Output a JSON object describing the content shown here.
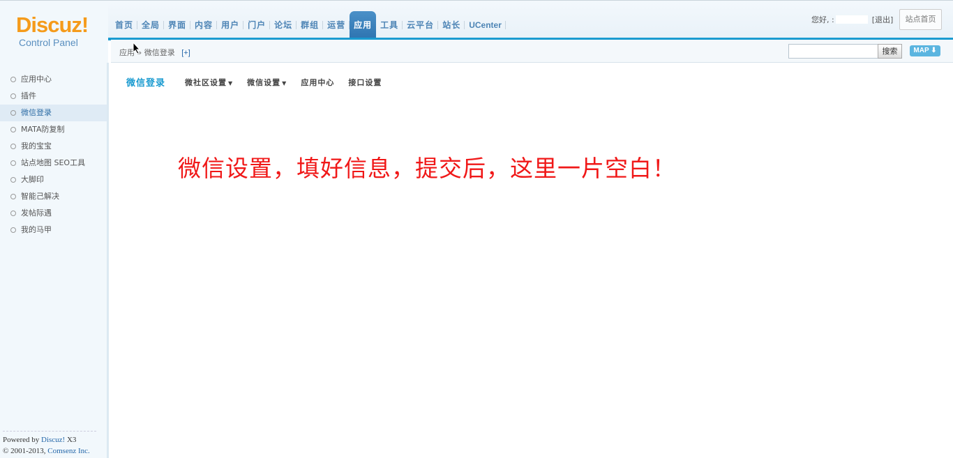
{
  "logo": {
    "main": "Discuz!",
    "sub": "Control Panel"
  },
  "topnav": {
    "items": [
      {
        "label": "首页",
        "active": false
      },
      {
        "label": "全局",
        "active": false
      },
      {
        "label": "界面",
        "active": false
      },
      {
        "label": "内容",
        "active": false
      },
      {
        "label": "用户",
        "active": false
      },
      {
        "label": "门户",
        "active": false
      },
      {
        "label": "论坛",
        "active": false
      },
      {
        "label": "群组",
        "active": false
      },
      {
        "label": "运营",
        "active": false
      },
      {
        "label": "应用",
        "active": true
      },
      {
        "label": "工具",
        "active": false
      },
      {
        "label": "云平台",
        "active": false
      },
      {
        "label": "站长",
        "active": false
      },
      {
        "label": "UCenter",
        "active": false
      }
    ]
  },
  "user": {
    "greeting": "您好, :",
    "logout": "[退出]",
    "home": "站点首页"
  },
  "breadcrumb": {
    "path": "应用 » 微信登录",
    "add": "[+]"
  },
  "search": {
    "placeholder": "",
    "button": "搜索",
    "map": "MAP"
  },
  "sidebar": {
    "items": [
      {
        "label": "应用中心",
        "active": false
      },
      {
        "label": "插件",
        "active": false
      },
      {
        "label": "微信登录",
        "active": true
      },
      {
        "label": "MATA防复制",
        "active": false
      },
      {
        "label": "我的宝宝",
        "active": false
      },
      {
        "label": "站点地图 SEO工具",
        "active": false
      },
      {
        "label": "大脚印",
        "active": false
      },
      {
        "label": "智能己解决",
        "active": false
      },
      {
        "label": "发帖际遇",
        "active": false
      },
      {
        "label": "我的马甲",
        "active": false
      }
    ],
    "footer": {
      "powered": "Powered by",
      "brand": "Discuz!",
      "version": "X3",
      "copyright": "© 2001-2013,",
      "company": "Comsenz Inc."
    }
  },
  "content": {
    "title": "微信登录",
    "tabs": [
      {
        "label": "微社区设置",
        "dropdown": true
      },
      {
        "label": "微信设置",
        "dropdown": true
      },
      {
        "label": "应用中心",
        "dropdown": false
      },
      {
        "label": "接口设置",
        "dropdown": false
      }
    ],
    "annotation": "微信设置，填好信息，提交后，这里一片空白！"
  },
  "colors": {
    "accent": "#1b9bd0",
    "logo": "#f59b1b",
    "annotation": "#f01818"
  }
}
